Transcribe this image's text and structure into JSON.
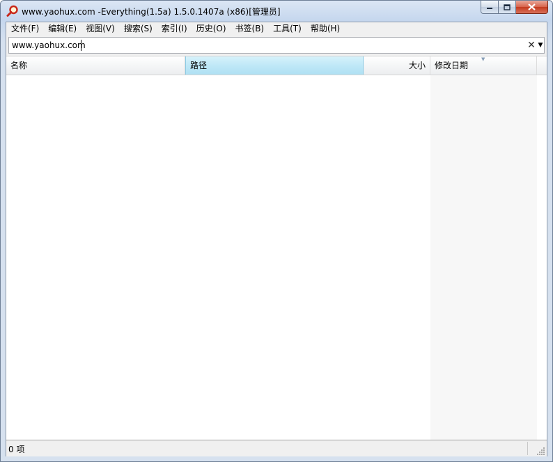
{
  "window": {
    "title": "www.yaohux.com -Everything(1.5a) 1.5.0.1407a (x86)[管理员]",
    "icon": "magnifier-icon",
    "accent_color": "#c43b1f"
  },
  "menu": [
    {
      "label": "文件(F)"
    },
    {
      "label": "编辑(E)"
    },
    {
      "label": "视图(V)"
    },
    {
      "label": "搜索(S)"
    },
    {
      "label": "索引(I)"
    },
    {
      "label": "历史(O)"
    },
    {
      "label": "书签(B)"
    },
    {
      "label": "工具(T)"
    },
    {
      "label": "帮助(H)"
    }
  ],
  "search": {
    "value": "www.yaohux.com",
    "clear_glyph": "✕",
    "dropdown_glyph": "▼"
  },
  "columns": {
    "name": "名称",
    "path": "路径",
    "size": "大小",
    "modified": "修改日期",
    "sorted_column": "路径"
  },
  "results": [],
  "status": {
    "text": "0 项"
  }
}
